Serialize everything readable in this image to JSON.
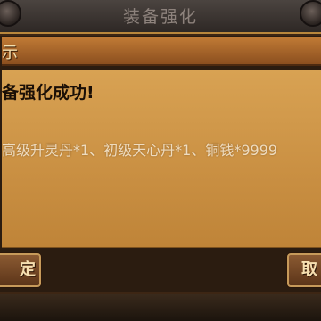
{
  "window": {
    "title": "装备强化"
  },
  "dialog": {
    "header": "示",
    "message": "备强化成功!",
    "reward_text": "高级升灵丹*1、初级天心丹*1、铜钱*9999",
    "confirm_label": "定",
    "cancel_label": "取"
  },
  "colors": {
    "body_gold": "#d09a4a",
    "header_orange": "#b06d2d",
    "frame_dark": "#2b1c10",
    "button_brown": "#74462a"
  }
}
